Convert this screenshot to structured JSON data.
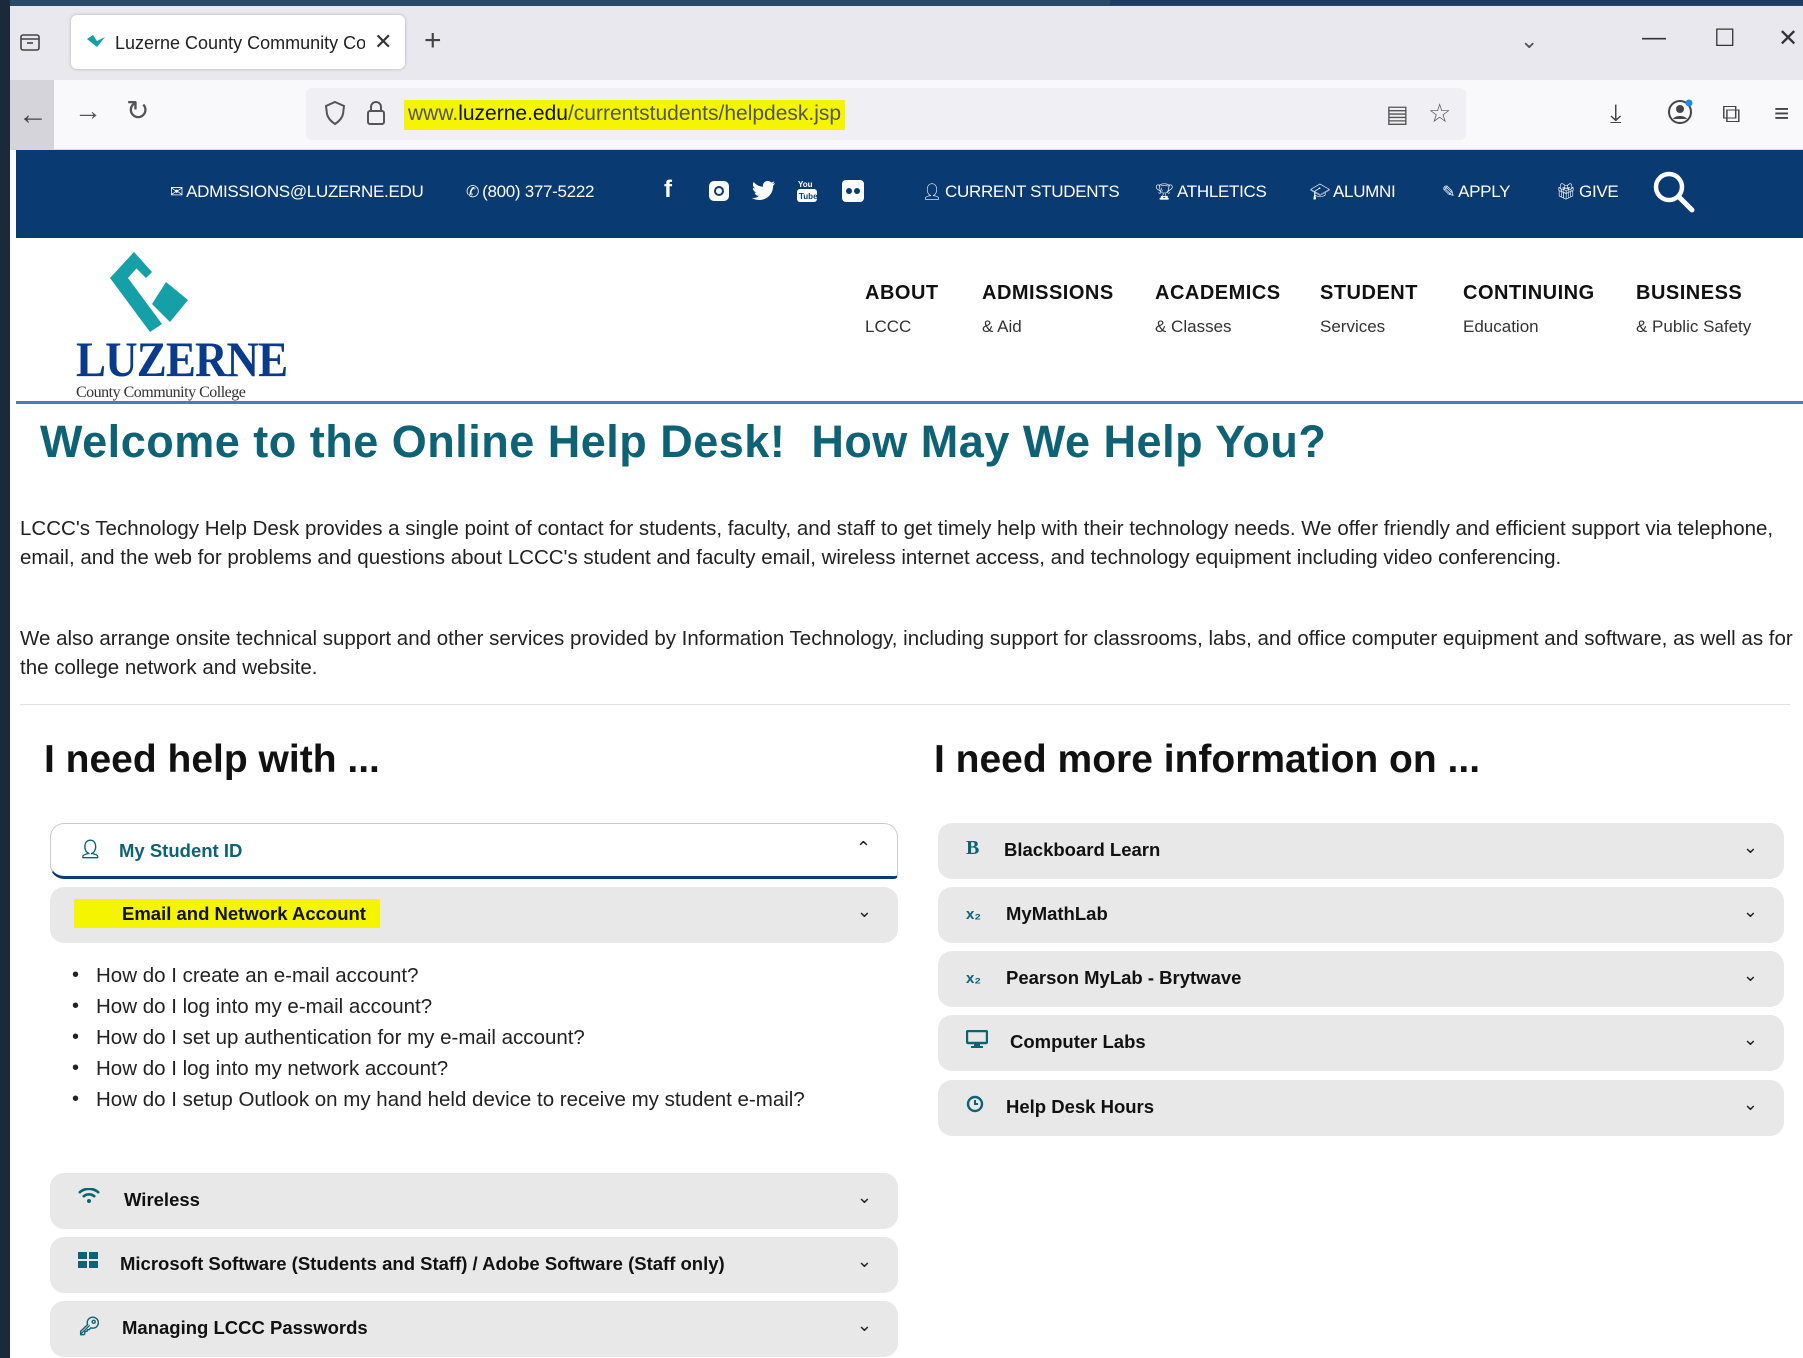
{
  "browser": {
    "tab_title": "Luzerne County Community Col",
    "url_domain_prefix": "www.",
    "url_domain": "luzerne.edu",
    "url_path": "/currentstudents/helpdesk.jsp"
  },
  "topbar": {
    "email": "ADMISSIONS@LUZERNE.EDU",
    "phone": "(800) 377-5222",
    "links": [
      "CURRENT STUDENTS",
      "ATHLETICS",
      "ALUMNI",
      "APPLY",
      "GIVE"
    ]
  },
  "logo": {
    "name": "LUZERNE",
    "subtitle": "County Community College"
  },
  "nav": [
    {
      "title": "ABOUT",
      "sub": "LCCC"
    },
    {
      "title": "ADMISSIONS",
      "sub": "& Aid"
    },
    {
      "title": "ACADEMICS",
      "sub": "& Classes"
    },
    {
      "title": "STUDENT",
      "sub": "Services"
    },
    {
      "title": "CONTINUING",
      "sub": "Education"
    },
    {
      "title": "BUSINESS",
      "sub": "& Public Safety"
    }
  ],
  "page": {
    "heading": "Welcome to the Online Help Desk!  How May We Help You?",
    "para1": "LCCC's Technology Help Desk provides a single point of contact for students, faculty, and staff to get timely help with their technology needs. We offer friendly and efficient support via telephone, email, and the web for problems and questions about LCCC's student and faculty email, wireless internet access, and technology equipment including video conferencing.",
    "para2": "We also arrange onsite technical support and other services provided by Information Technology, including support for classrooms, labs, and office computer equipment and software, as well as for the college network and website."
  },
  "left": {
    "heading": "I need help with ...",
    "items": [
      "My Student ID",
      "Email and Network Account",
      "Wireless",
      "Microsoft Software (Students and Staff) / Adobe Software (Staff only)",
      "Managing LCCC Passwords"
    ],
    "email_questions": [
      "How do I create an e-mail account?",
      "How do I log into my e-mail account?",
      "How do I set up authentication for my e-mail account?",
      "How do I log into my network account?",
      "How do I setup Outlook on my hand held device to receive my student e-mail?"
    ]
  },
  "right": {
    "heading": "I need more information on ...",
    "items": [
      "Blackboard Learn",
      "MyMathLab",
      "Pearson MyLab - Brytwave",
      "Computer Labs",
      "Help Desk Hours"
    ]
  },
  "colors": {
    "site_blue": "#0a3a72",
    "teal": "#0d6275",
    "highlight": "#f5f500"
  }
}
